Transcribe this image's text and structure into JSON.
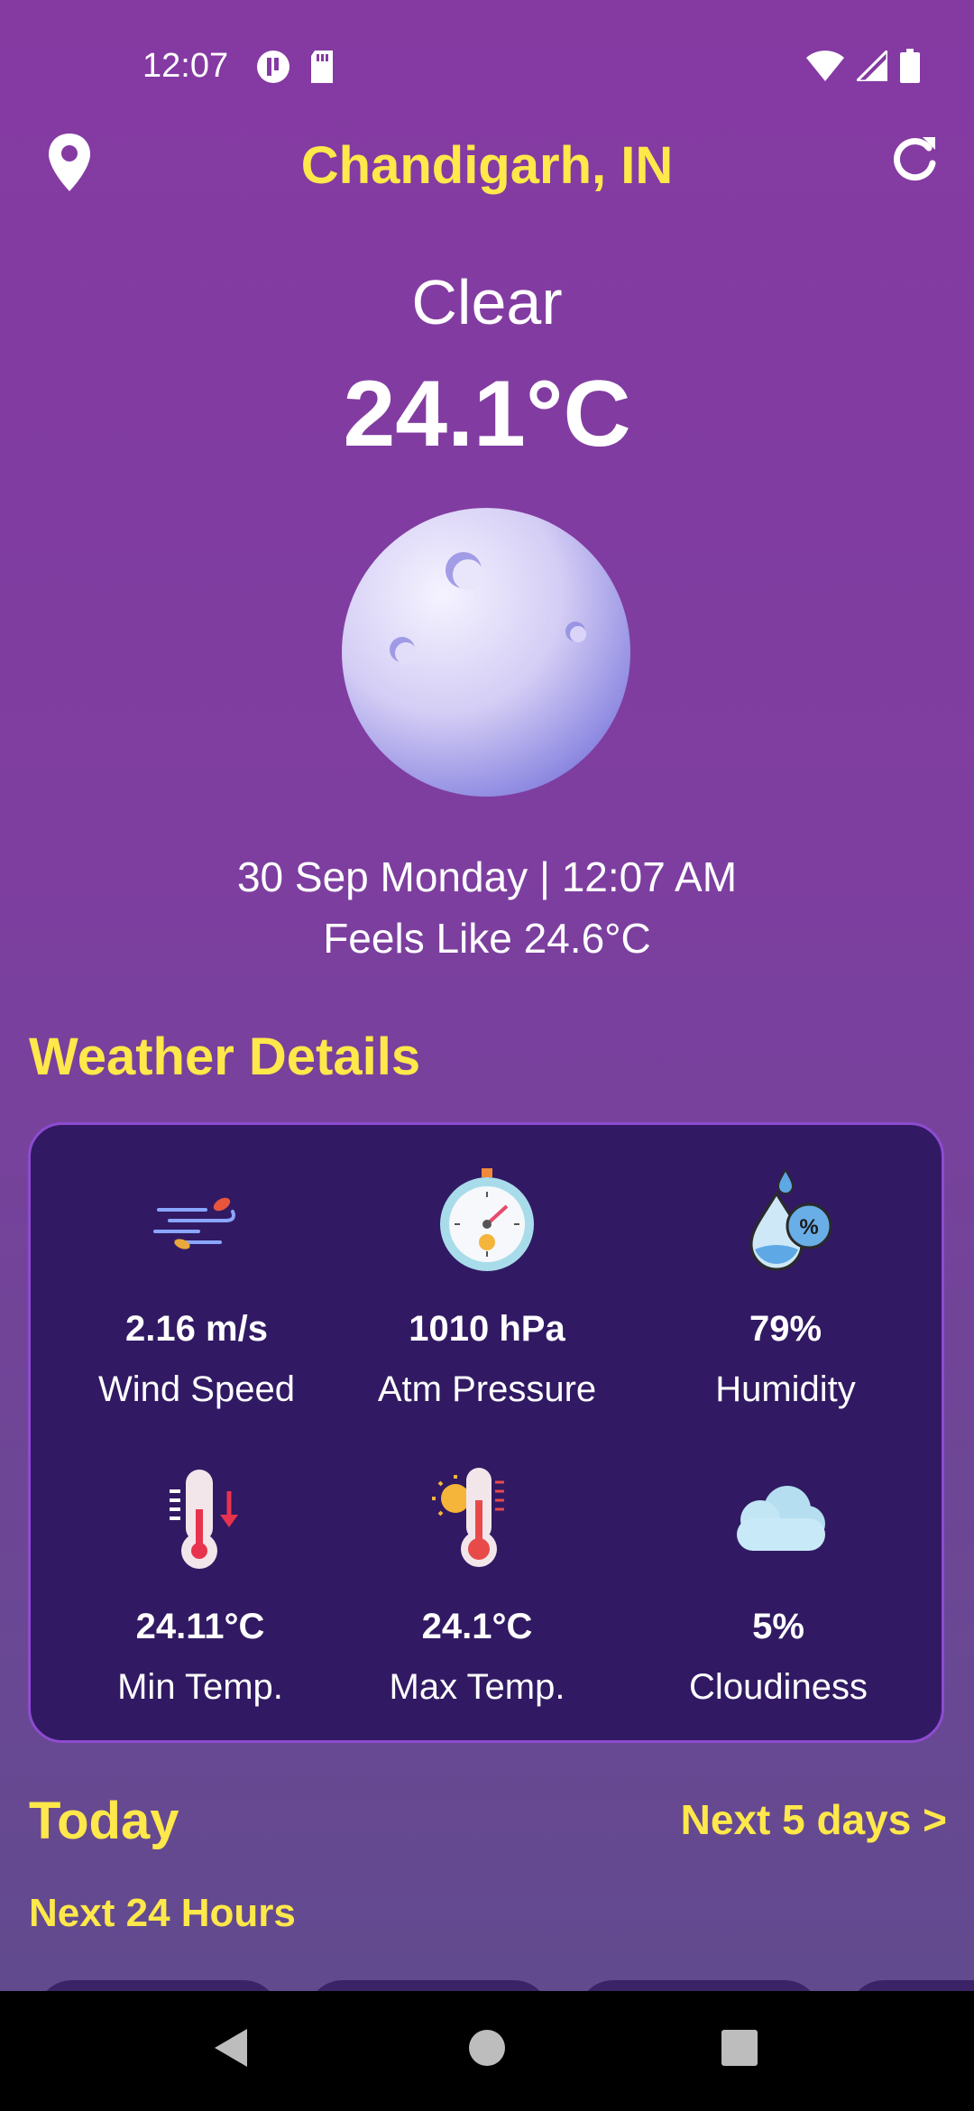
{
  "status_bar": {
    "time": "12:07"
  },
  "header": {
    "city": "Chandigarh, IN"
  },
  "current": {
    "condition": "Clear",
    "temperature": "24.1°C",
    "date_time": "30 Sep Monday | 12:07 AM",
    "feels_like": "Feels Like 24.6°C"
  },
  "details": {
    "title": "Weather Details",
    "items": [
      {
        "value": "2.16 m/s",
        "label": "Wind Speed",
        "icon": "wind-icon"
      },
      {
        "value": "1010 hPa",
        "label": "Atm Pressure",
        "icon": "barometer-icon"
      },
      {
        "value": "79%",
        "label": "Humidity",
        "icon": "humidity-icon"
      },
      {
        "value": "24.11°C",
        "label": "Min Temp.",
        "icon": "thermometer-low-icon"
      },
      {
        "value": "24.1°C",
        "label": "Max Temp.",
        "icon": "thermometer-high-icon"
      },
      {
        "value": "5%",
        "label": "Cloudiness",
        "icon": "cloud-icon"
      }
    ]
  },
  "forecast": {
    "today": "Today",
    "next_days_link": "Next 5 days >",
    "next_24": "Next 24 Hours"
  },
  "colors": {
    "accent": "#ffe84a",
    "card": "#311a63",
    "card_border": "#8e4bd0"
  }
}
